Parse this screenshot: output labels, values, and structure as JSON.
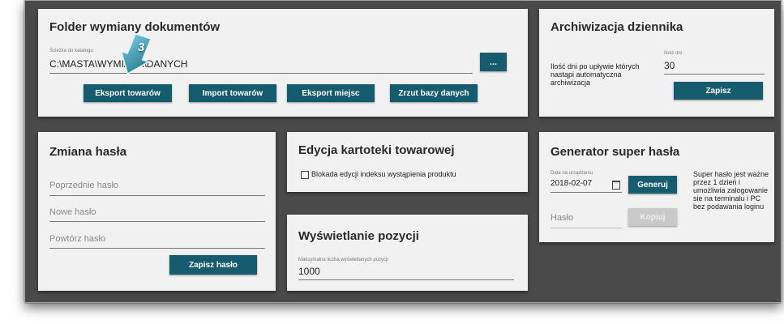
{
  "folder": {
    "title": "Folder wymiany dokumentów",
    "path_label": "Ścieżka do katalogu",
    "path_value": "C:\\MASTA\\WYMIANA\\DANYCH",
    "browse_label": "...",
    "buttons": [
      "Eksport towarów",
      "Import towarów",
      "Eksport miejsc",
      "Zrzut bazy danych"
    ]
  },
  "badge": {
    "number": "3"
  },
  "archive": {
    "title": "Archiwizacja dziennika",
    "description": "Ilość dni po upływie których nastąpi automatyczna archiwizacja",
    "days_label": "Ilość dni",
    "days_value": "30",
    "save_label": "Zapisz"
  },
  "password": {
    "title": "Zmiana hasła",
    "old_placeholder": "Poprzednie hasło",
    "new_placeholder": "Nowe hasło",
    "repeat_placeholder": "Powtórz hasło",
    "save_label": "Zapisz hasło"
  },
  "products": {
    "title": "Edycja kartoteki towarowej",
    "checkbox_label": "Blokada edycji indeksu wystąpienia produktu"
  },
  "display": {
    "title": "Wyświetlanie pozycji",
    "max_label": "Maksymalna liczba wyświetlanych pozycji",
    "max_value": "1000"
  },
  "generator": {
    "title": "Generator super hasła",
    "date_label": "Data na urządzeniu",
    "date_value": "2018-02-07",
    "generate_label": "Generuj",
    "password_placeholder": "Hasło",
    "copy_label": "Kopiuj",
    "info": "Super hasło jest ważne przez 1 dzień i umożliwia zalogowanie sie na terminalu i PC bez podawania loginu"
  },
  "colors": {
    "accent": "#155c6f",
    "background": "#4a4a4a",
    "card": "#f1f1f1"
  }
}
